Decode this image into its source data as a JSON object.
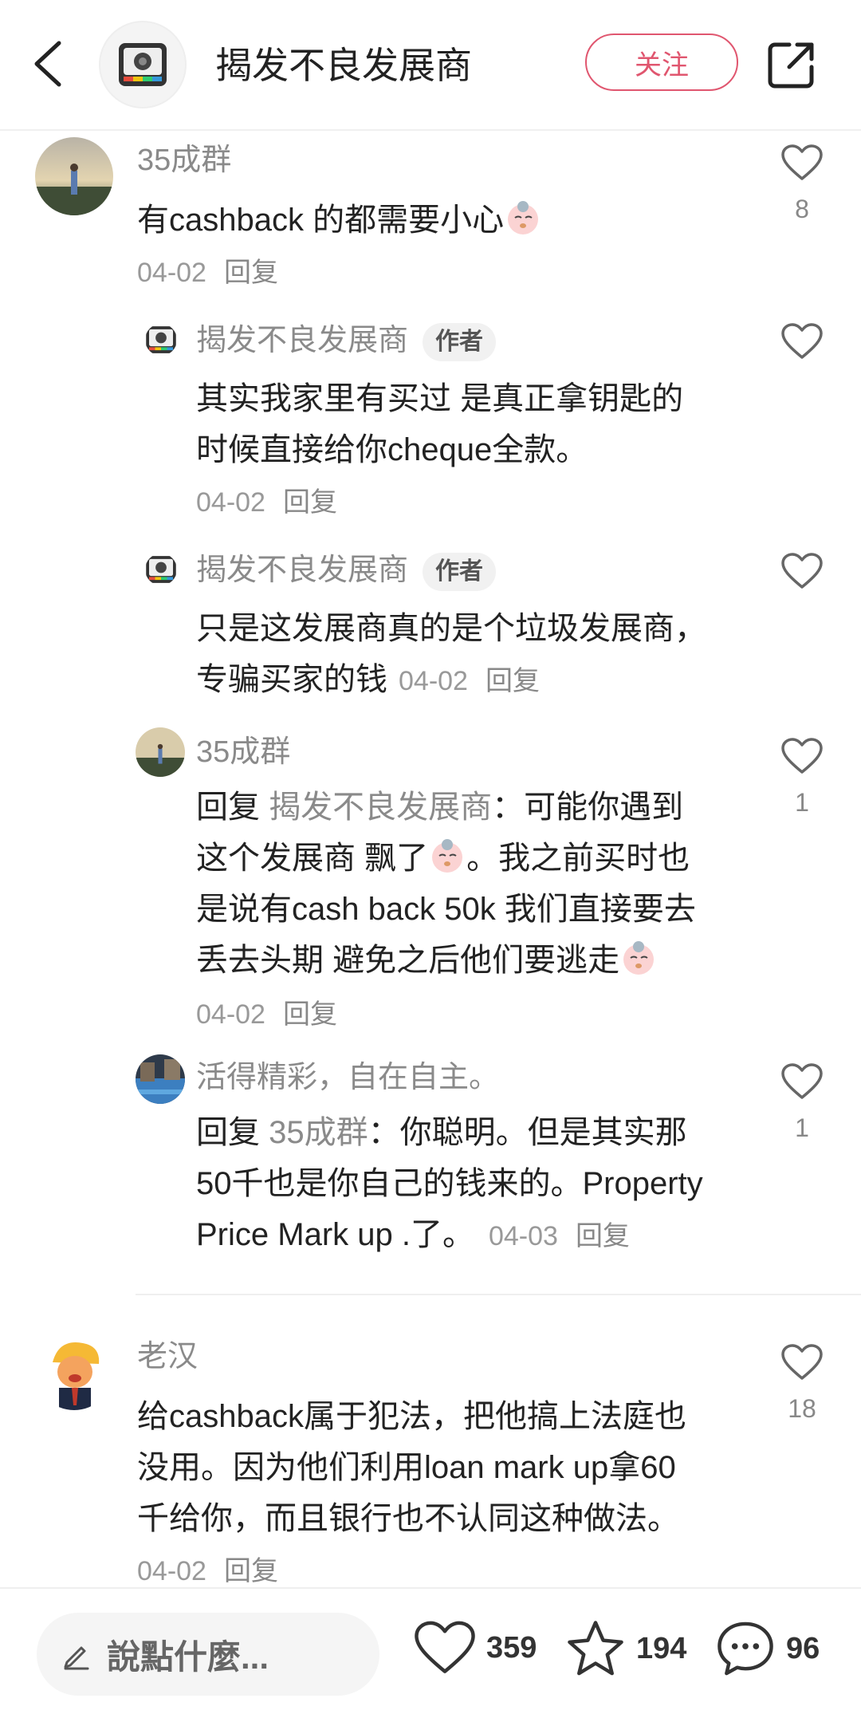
{
  "header": {
    "title": "揭发不良发展商",
    "follow_label": "关注"
  },
  "comments": [
    {
      "user": "35成群",
      "text": "有cashback 的都需要小心",
      "date": "04-02",
      "reply_label": "回复",
      "likes": "8"
    },
    {
      "user": "揭发不良发展商",
      "badge": "作者",
      "text_lines": [
        "其实我家里有买过 是真正拿钥匙的",
        "时候直接给你cheque全款。"
      ],
      "date": "04-02",
      "reply_label": "回复"
    },
    {
      "user": "揭发不良发展商",
      "badge": "作者",
      "text_lines": [
        "只是这发展商真的是个垃圾发展商，",
        "专骗买家的钱"
      ],
      "date": "04-02",
      "reply_label": "回复"
    },
    {
      "user": "35成群",
      "reply_prefix": "回复",
      "mention": "揭发不良发展商",
      "text_lines": [
        "：可能你遇到",
        "这个发展商 飘了",
        "。我之前买时也",
        "是说有cash back 50k 我们直接要去",
        "丢去头期 避免之后他们要逃走"
      ],
      "date": "04-02",
      "reply_label": "回复",
      "likes": "1"
    },
    {
      "user": "活得精彩，自在自主。",
      "reply_prefix": "回复",
      "mention": "35成群",
      "text_lines": [
        "：你聪明。但是其实那",
        "50千也是你自己的钱来的。Property",
        "Price Mark up .了。"
      ],
      "date": "04-03",
      "reply_label": "回复",
      "likes": "1"
    },
    {
      "user": "老汉",
      "text_lines": [
        "给cashback属于犯法，把他搞上法庭也",
        "没用。因为他们利用loan mark up拿60",
        "千给你，而且银行也不认同这种做法。"
      ],
      "date": "04-02",
      "reply_label": "回复",
      "likes": "18"
    }
  ],
  "bottom_bar": {
    "input_placeholder": "說點什麼...",
    "likes": "359",
    "favorites": "194",
    "comments": "96"
  },
  "colors": {
    "accent": "#e0566f",
    "muted": "#8a8a8a"
  },
  "icons": [
    "back-icon",
    "share-icon",
    "heart-icon",
    "star-icon",
    "chat-icon",
    "pen-icon"
  ]
}
